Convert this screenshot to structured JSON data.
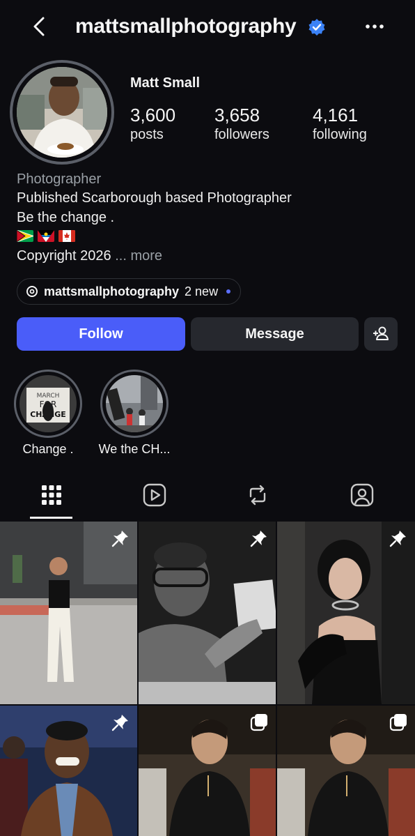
{
  "header": {
    "username": "mattsmallphotography"
  },
  "profile": {
    "display_name": "Matt Small",
    "stats": [
      {
        "value": "3,600",
        "label": "posts"
      },
      {
        "value": "3,658",
        "label": "followers"
      },
      {
        "value": "4,161",
        "label": "following"
      }
    ],
    "category": "Photographer",
    "bio_lines": [
      "Published Scarborough based Photographer",
      "Be the change ."
    ],
    "flags": [
      "guyana-flag-icon",
      "antigua-flag-icon",
      "canada-flag-icon"
    ],
    "copyright": "Copyright 2026",
    "more": "... more"
  },
  "threads": {
    "handle": "mattsmallphotography",
    "new": "2 new"
  },
  "actions": {
    "follow": "Follow",
    "message": "Message"
  },
  "highlights": [
    {
      "label": "Change ."
    },
    {
      "label": "We the CH..."
    }
  ],
  "tabs": [
    "grid-icon",
    "reels-icon",
    "reposts-icon",
    "tagged-icon"
  ],
  "grid": {
    "posts": [
      {
        "name": "post-woman-white-pants",
        "badge": "pin-icon"
      },
      {
        "name": "post-oprah-bw",
        "badge": "pin-icon"
      },
      {
        "name": "post-woman-black-dress",
        "badge": "pin-icon"
      },
      {
        "name": "post-man-smiling",
        "badge": "pin-icon"
      },
      {
        "name": "post-man-black-shirt",
        "badge": "multi-photo-icon"
      },
      {
        "name": "post-man-black-shirt-2",
        "badge": "multi-photo-icon"
      }
    ]
  },
  "colors": {
    "background": "#0c0c10",
    "follow_button": "#4a5df9",
    "secondary_button": "#26282e",
    "verified": "#3b82f6"
  }
}
